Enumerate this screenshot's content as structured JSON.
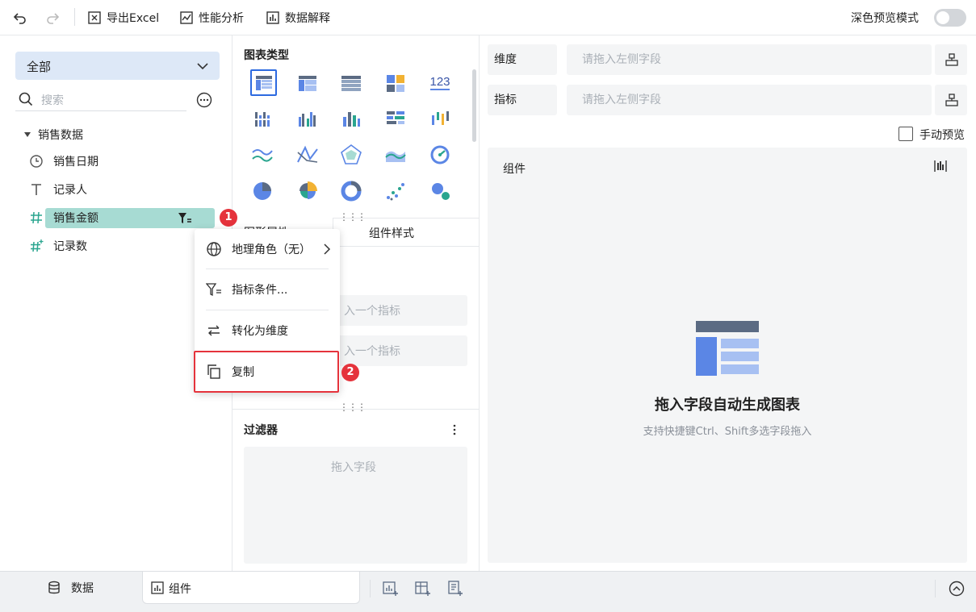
{
  "toolbar": {
    "undo_icon": "undo-icon",
    "redo_icon": "redo-icon",
    "export_label": "导出Excel",
    "perf_label": "性能分析",
    "explain_label": "数据解释",
    "dark_preview_label": "深色预览模式",
    "dark_preview_on": false
  },
  "left": {
    "scope_value": "全部",
    "search_placeholder": "搜索",
    "dataset_name": "销售数据",
    "fields": [
      {
        "label": "销售日期",
        "icon": "clock-icon"
      },
      {
        "label": "记录人",
        "icon": "text-icon"
      },
      {
        "label": "销售金额",
        "icon": "hash-icon"
      },
      {
        "label": "记录数",
        "icon": "hash-star-icon"
      }
    ]
  },
  "context_menu": {
    "items": [
      {
        "label": "地理角色（无）",
        "icon": "globe-icon"
      },
      {
        "label": "指标条件...",
        "icon": "filter-icon"
      },
      {
        "label": "转化为维度",
        "icon": "swap-icon"
      },
      {
        "label": "复制",
        "icon": "copy-icon"
      }
    ]
  },
  "badges": {
    "one": "1",
    "two": "2"
  },
  "middle": {
    "chart_types_title": "图表类型",
    "tab_partial": "图形属性",
    "tab_style": "组件样式",
    "slot_text": "入一个指标",
    "filter_title": "过滤器",
    "filter_drop": "拖入字段"
  },
  "right": {
    "dimension_label": "维度",
    "dimension_placeholder": "请拖入左侧字段",
    "metric_label": "指标",
    "metric_placeholder": "请拖入左侧字段",
    "manual_preview_label": "手动预览",
    "component_title": "组件",
    "empty_title": "拖入字段自动生成图表",
    "empty_hint": "支持快捷键Ctrl、Shift多选字段拖入"
  },
  "bottom": {
    "data_tab": "数据",
    "component_tab": "组件"
  },
  "colors": {
    "accent": "#5b86e5",
    "highlight_red": "#e5333c",
    "selected_field": "#a7dbd3",
    "scope_bg": "#dde8f7"
  }
}
